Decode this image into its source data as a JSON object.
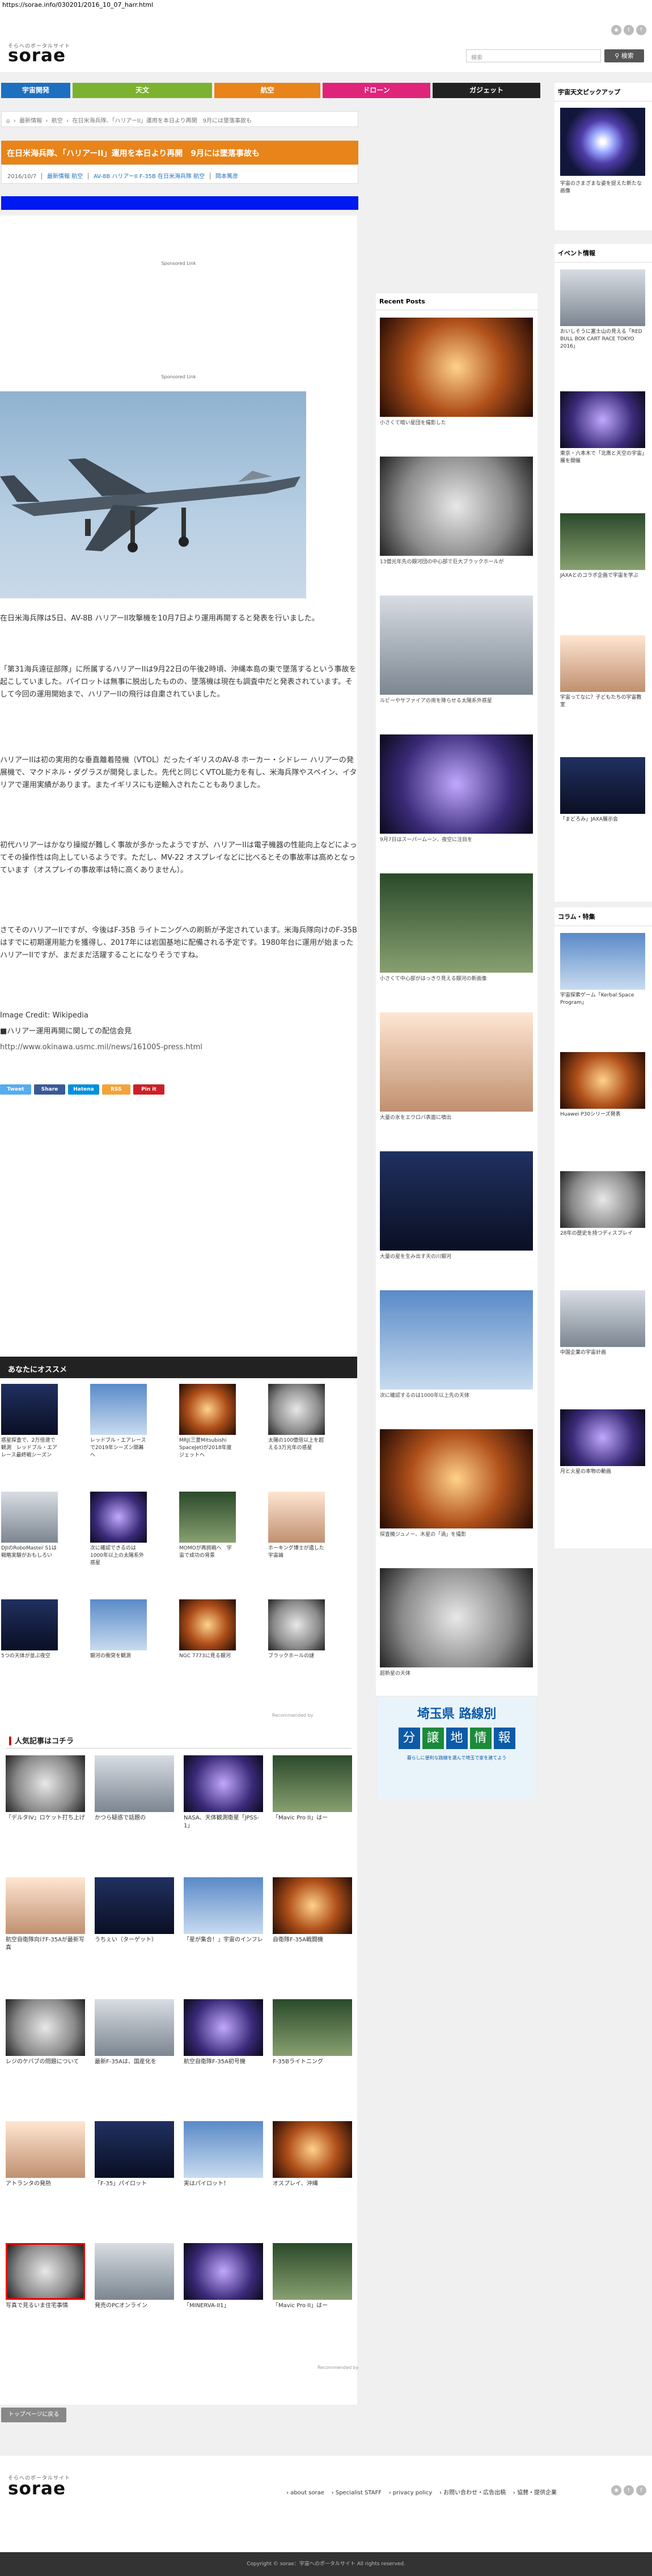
{
  "browser": {
    "url": "https://sorae.info/030201/2016_10_07_harr.html"
  },
  "site": {
    "tagline": "そらへのポータルサイト",
    "logo": "sorae",
    "search_placeholder": "検索",
    "search_button": "検索",
    "social_icons": [
      "rss",
      "twitter",
      "facebook"
    ]
  },
  "nav": [
    {
      "label": "宇宙開発",
      "color": "#1d6fc0"
    },
    {
      "label": "天文",
      "color": "#7cb230"
    },
    {
      "label": "航空",
      "color": "#e8841a"
    },
    {
      "label": "ドローン",
      "color": "#e0247a"
    },
    {
      "label": "ガジェット",
      "color": "#222222"
    }
  ],
  "breadcrumb": {
    "home": "⌂",
    "items": [
      "最新情報",
      "航空",
      "在日米海兵隊、「ハリアーII」運用を本日より再開　9月には墜落事故も"
    ]
  },
  "article": {
    "title": "在日米海兵隊、「ハリアーII」運用を本日より再開　9月には墜落事故も",
    "date": "2016/10/7",
    "tags": [
      "最新情報 航空",
      "AV-8B ハリアーII F-35B 在日米海兵隊 航空",
      "岡本篤彦"
    ],
    "sponsored": "Sponsored Link",
    "paragraphs": [
      "在日米海兵隊は5日、AV-8B ハリアーII攻撃機を10月7日より運用再開すると発表を行いました。",
      "「第31海兵遠征部隊」に所属するハリアーIIは9月22日の午後2時頃、沖縄本島の東で墜落するという事故を起こしていました。パイロットは無事に脱出したものの、墜落機は現在も調査中だと発表されています。そして今回の運用開始まで、ハリアーIIの飛行は自粛されていました。",
      "ハリアーIIは初の実用的な垂直離着陸機（VTOL）だったイギリスのAV-8 ホーカー・シドレー ハリアーの発展機で、マクドネル・ダグラスが開発しました。先代と同じくVTOL能力を有し、米海兵隊やスペイン、イタリアで運用実績があります。またイギリスにも逆輸入されたこともありました。",
      "初代ハリアーはかなり操縦が難しく事故が多かったようですが、ハリアーIIは電子機器の性能向上などによってその操作性は向上しているようです。ただし、MV-22 オスプレイなどに比べるとその事故率は高めとなっています（オスプレイの事故率は特に高くありません）。",
      "さてそのハリアーIIですが、今後はF-35B ライトニングへの刷新が予定されています。米海兵隊向けのF-35Bはすでに初期運用能力を獲得し、2017年には岩国基地に配備される予定です。1980年台に運用が始まったハリアーIIですが、まだまだ活躍することになりそうですね。"
    ],
    "image_credit": "Image Credit: Wikipedia",
    "source_title": "■ハリアー運用再開に関しての配信会見",
    "source_url": "http://www.okinawa.usmc.mil/news/161005-press.html",
    "share": [
      {
        "label": "Tweet",
        "color": "#55acee"
      },
      {
        "label": "Share",
        "color": "#3b5998"
      },
      {
        "label": "Hatena",
        "color": "#008fde"
      },
      {
        "label": "RSS",
        "color": "#f3a33b"
      },
      {
        "label": "Pin it",
        "color": "#cb2027"
      }
    ]
  },
  "recommend": {
    "header": "あなたにオススメ",
    "rows": [
      [
        "惑星探査で、2万倍速で観測　レッドブル・エアレース最終戦シーズン",
        "レッドブル・エアレースで2019年シーズン開幕へ",
        "MRJ(三菱Mitsubishi SpaceJet)が2018年度ジェットへ",
        "太陽の100億倍以上を超える3万光年の惑星"
      ],
      [
        "DJIのRoboMaster S1は戦略実験がおもしろい",
        "次に確認できるのは1000年以上の太陽系外惑星",
        "MOMOが再挑戦へ　宇宙で成功の背景",
        "ホーキング博士が遺した宇宙論"
      ],
      [
        "5つの天体が並ぶ夜空",
        "銀河の衝突を観測",
        "NGC 7773に見る銀河",
        "ブラックホールの謎"
      ]
    ],
    "footer": "Recommended by"
  },
  "popular": {
    "header": "人気記事はコチラ",
    "rows": [
      [
        "「デルタIV」ロケット打ち上げ",
        "かつら疑惑で話題の",
        "NASA、天体観測衛星「JPSS-1」",
        "「Mavic Pro II」はー"
      ],
      [
        "航空自衛隊向けF-35Aが最新写真",
        "うちぇい（ターゲット）",
        "「星が集合！」宇宙のインフレ",
        "自衛隊F-35A戦闘機"
      ],
      [
        "レジのケバブの問題について",
        "最新F-35Aは、国産化を",
        "航空自衛隊F-35A初号機",
        "F-35Bライトニング"
      ],
      [
        "アトランタの発熱",
        "「F-35」パイロット",
        "実はパイロット！",
        "オスプレイ、沖縄"
      ],
      [
        "写真で見るいま住宅事情",
        "発売のPCオンライン",
        "「MINERVA-II1」",
        "「Mavic Pro II」はー"
      ]
    ],
    "footer": "Recommended by"
  },
  "recent": {
    "header": "Recent Posts",
    "items": [
      "小さくて暗い星団を撮影した",
      "13億光年先の銀河団の中心部で巨大ブラックホールが",
      "ルビーやサファイアの雨を降らせる太陽系外惑星",
      "9月7日はスーパームーン、夜空に注目を",
      "小さくて中心部がはっきり見える銀河の新画像",
      "大量の氷をエウロパ表面に噴出",
      "大量の星を生み出す天の川銀河",
      "次に確認するのは1000年以上先の天体",
      "探査機ジュノー、木星の「渦」を撮影",
      "超新星の天体"
    ]
  },
  "pickup": {
    "header": "宇宙天文ピックアップ",
    "caption": "宇宙のさまざまな姿を捉えた新たな画像"
  },
  "events": {
    "header": "イベント情報",
    "items": [
      "おいしそうに富士山の見える「RED BULL BOX CART RACE TOKYO 2016」",
      "東京・六本木で「北斎と天空の宇宙」展を開催",
      "JAXAとのコラボ企画で宇宙を学ぶ",
      "宇宙ってなに？子どもたちの宇宙教室",
      "「まどろみ」JAXA展示会"
    ]
  },
  "columns": {
    "header": "コラム・特集",
    "items": [
      "宇宙探索ゲーム「Kerbal Space Program」",
      "Huawei P30シリーズ発表",
      "28年の歴史を持つディスプレイ",
      "中国企業の宇宙計画",
      "月と火星の本物の動画"
    ]
  },
  "ad": {
    "title": "埼玉県 路線別",
    "words": [
      "分",
      "譲",
      "地",
      "情",
      "報"
    ],
    "sub": "暮らしに便利な路線を選んで埼玉で家を建てよう"
  },
  "back_button": "トップページに戻る",
  "footer": {
    "links": [
      "about sorae",
      "Specialist STAFF",
      "privacy policy",
      "お問い合わせ・広告出稿",
      "協賛・提供企業"
    ],
    "copyright": "Copyright © sorae：宇宙へのポータルサイト All rights reserved."
  }
}
